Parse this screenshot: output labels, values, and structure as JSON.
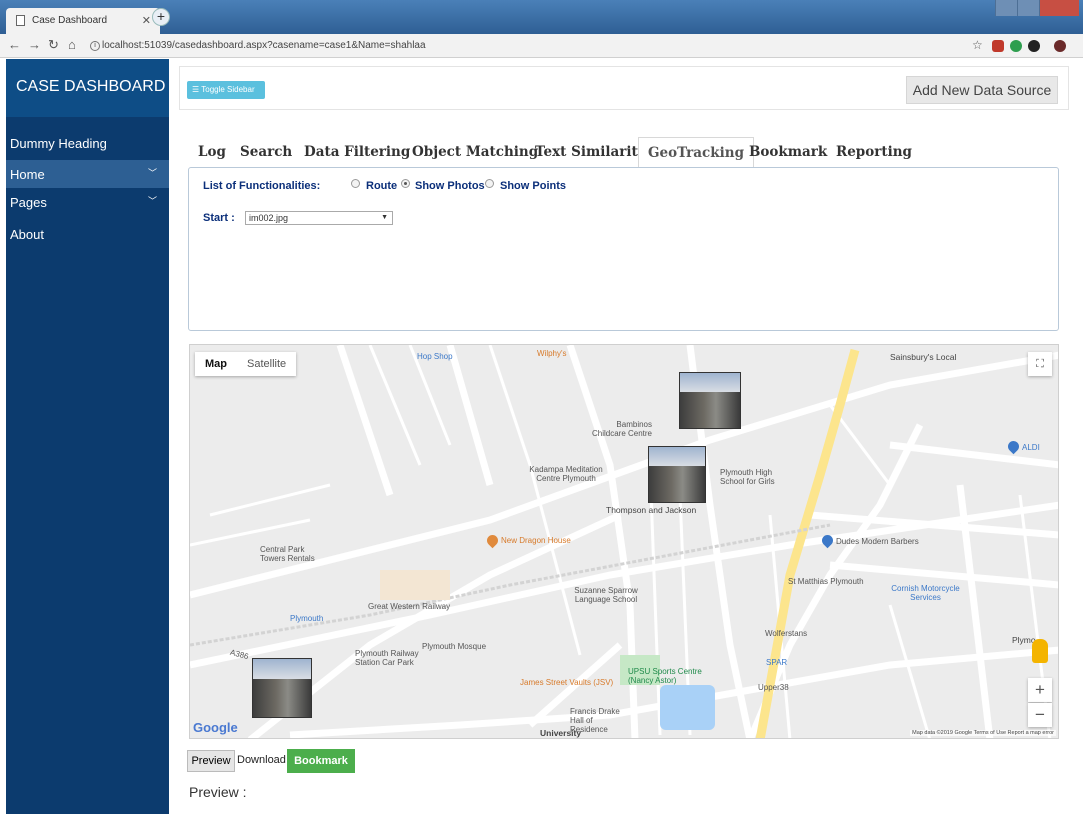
{
  "browser": {
    "tab_title": "Case Dashboard",
    "url": "localhost:51039/casedashboard.aspx?casename=case1&Name=shahlaa"
  },
  "sidebar": {
    "title": "CASE DASHBOARD",
    "items": [
      {
        "label": "Dummy Heading"
      },
      {
        "label": "Home"
      },
      {
        "label": "Pages"
      },
      {
        "label": "About"
      }
    ]
  },
  "toolbar": {
    "toggle_label": "Toggle Sidebar",
    "add_source_label": "Add New Data Source"
  },
  "tabs": [
    "Log",
    "Search",
    "Data Filtering",
    "Object Matching",
    "Text Similarity",
    "GeoTracking",
    "Bookmark",
    "Reporting"
  ],
  "active_tab": "GeoTracking",
  "panel": {
    "functionalities_label": "List of Functionalities:",
    "options": [
      "Route",
      "Show Photos",
      "Show Points"
    ],
    "selected_option": "Show Photos",
    "start_label": "Start :",
    "start_value": "im002.jpg"
  },
  "map": {
    "type_map": "Map",
    "type_satellite": "Satellite",
    "logo": "Google",
    "attribution": "Map data ©2019 Google   Terms of Use   Report a map error",
    "zoom_in": "+",
    "zoom_out": "−",
    "labels": {
      "hop_shop": "Hop Shop",
      "wilphys": "Wilphy's",
      "sainsburys": "Sainsbury's Local",
      "bambinos": "Bambinos Childcare Centre",
      "kadampa": "Kadampa Meditation Centre Plymouth",
      "plymouth_high": "Plymouth High School for Girls",
      "thompson": "Thompson and Jackson",
      "aldi": "ALDI",
      "new_dragon": "New Dragon House",
      "central_park": "Central Park Towers Rentals",
      "dudes": "Dudes Modern Barbers",
      "st_matthias": "St Matthias Plymouth",
      "cornish": "Cornish Motorcycle Services",
      "suzanne": "Suzanne Sparrow Language School",
      "gwr": "Great Western Railway",
      "plymouth": "Plymouth",
      "mosque": "Plymouth Mosque",
      "car_park": "Plymouth Railway Station Car Park",
      "upsu": "UPSU Sports Centre (Nancy Astor)",
      "spar": "SPAR",
      "wolferstans": "Wolferstans",
      "upper38": "Upper38",
      "james_street": "James Street Vaults (JSV)",
      "francis_drake": "Francis Drake Hall of Residence",
      "university": "University",
      "a386": "A386",
      "plymo": "Plymo"
    }
  },
  "actions": {
    "preview": "Preview",
    "download": "Download",
    "bookmark": "Bookmark"
  },
  "preview_heading": "Preview :",
  "colors": {
    "sidebar_bg": "#0c3b6e",
    "sidebar_header_bg": "#0e4d86",
    "home_active_bg": "#2d5f93",
    "toggle_btn": "#5bc0de",
    "bookmark_btn": "#4cae4c",
    "label_blue": "#0b2f7a"
  }
}
